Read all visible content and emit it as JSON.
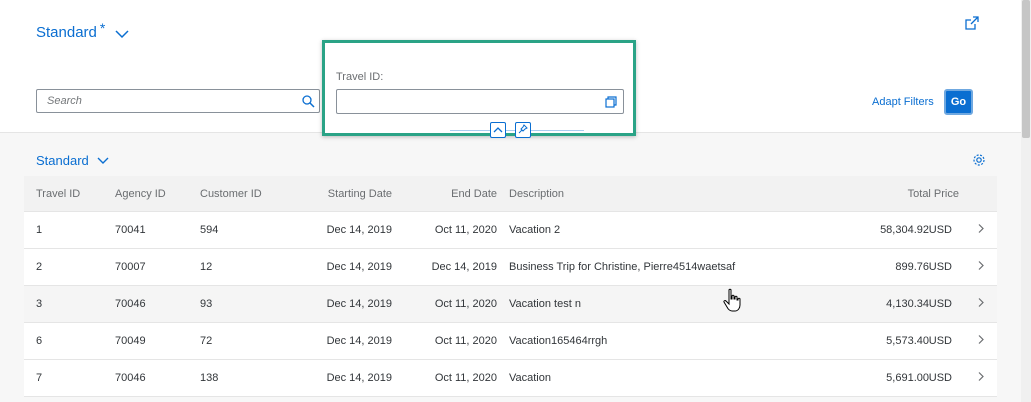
{
  "header": {
    "variant_title": "Standard",
    "variant_modified": "*",
    "search_placeholder": "Search",
    "filter_label": "Travel ID:",
    "filter_value": "",
    "adapt_filters": "Adapt Filters",
    "go": "Go"
  },
  "table": {
    "title": "Standard",
    "columns": [
      "Travel ID",
      "Agency ID",
      "Customer ID",
      "Starting Date",
      "End Date",
      "Description",
      "Total Price"
    ],
    "rows": [
      {
        "travel_id": "1",
        "agency_id": "70041",
        "customer_id": "594",
        "start": "Dec 14, 2019",
        "end": "Oct 11, 2020",
        "desc": "Vacation 2",
        "price": "58,304.92",
        "currency": "USD"
      },
      {
        "travel_id": "2",
        "agency_id": "70007",
        "customer_id": "12",
        "start": "Dec 14, 2019",
        "end": "Dec 14, 2019",
        "desc": "Business Trip for Christine, Pierre4514waetsaf",
        "price": "899.76",
        "currency": "USD"
      },
      {
        "travel_id": "3",
        "agency_id": "70046",
        "customer_id": "93",
        "start": "Dec 14, 2019",
        "end": "Oct 11, 2020",
        "desc": "Vacation test n",
        "price": "4,130.34",
        "currency": "USD"
      },
      {
        "travel_id": "6",
        "agency_id": "70049",
        "customer_id": "72",
        "start": "Dec 14, 2019",
        "end": "Oct 11, 2020",
        "desc": "Vacation165464rrgh",
        "price": "5,573.40",
        "currency": "USD"
      },
      {
        "travel_id": "7",
        "agency_id": "70046",
        "customer_id": "138",
        "start": "Dec 14, 2019",
        "end": "Oct 11, 2020",
        "desc": "Vacation",
        "price": "5,691.00",
        "currency": "USD"
      }
    ]
  },
  "colors": {
    "accent": "#0a6ed1",
    "highlight_border": "#2aa386"
  }
}
